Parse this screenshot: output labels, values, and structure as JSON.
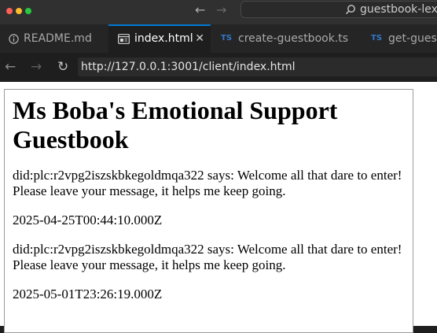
{
  "window": {
    "command_center_label": "guestbook-lexico"
  },
  "tabs": [
    {
      "label": "README.md",
      "icon": "info-icon",
      "active": false
    },
    {
      "label": "index.html",
      "icon": "preview-icon",
      "active": true,
      "close": "✕"
    },
    {
      "label": "create-guestbook.ts",
      "badge": "TS",
      "active": false
    },
    {
      "label": "get-guestb",
      "badge": "TS",
      "active": false
    }
  ],
  "browser": {
    "url": "http://127.0.0.1:3001/client/index.html"
  },
  "page": {
    "heading": "Ms Boba's Emotional Support Guestbook",
    "entries": [
      {
        "text": "did:plc:r2vpg2iszskbkegoldmqa322 says: Welcome all that dare to enter! Please leave your message, it helps me keep going.",
        "date": "2025-04-25T00:44:10.000Z"
      },
      {
        "text": "did:plc:r2vpg2iszskbkegoldmqa322 says: Welcome all that dare to enter! Please leave your message, it helps me keep going.",
        "date": "2025-05-01T23:26:19.000Z"
      }
    ]
  },
  "colors": {
    "traffic_close": "#ff5f57",
    "traffic_minimize": "#febc2e",
    "traffic_zoom": "#28c840",
    "active_tab_accent": "#0078d4",
    "ts_badge": "#3178c6"
  }
}
